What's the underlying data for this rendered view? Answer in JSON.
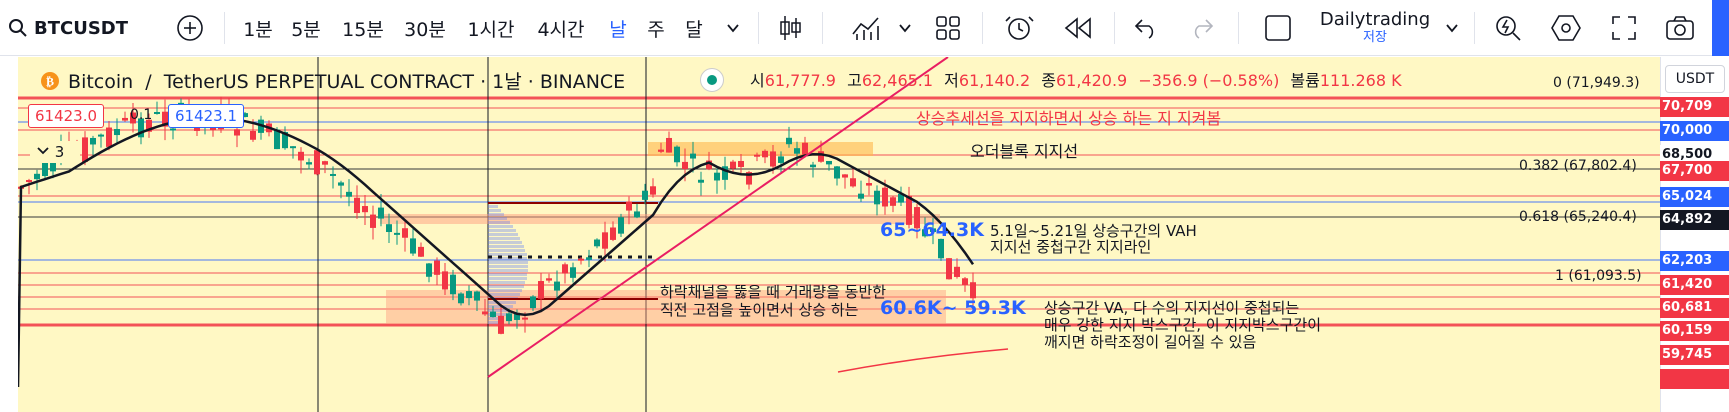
{
  "toolbar": {
    "symbol": "BTCUSDT",
    "intervals": [
      "1분",
      "5분",
      "15분",
      "30분",
      "1시간",
      "4시간",
      "날",
      "주",
      "달"
    ],
    "active_interval": "날",
    "layout_name": "Dailytrading",
    "save_label": "저장"
  },
  "legend": {
    "base": "Bitcoin",
    "sep": "/",
    "quote": "TetherUS PERPETUAL CONTRACT · 1날 · BINANCE",
    "o_label": "시",
    "o_value": "61,777.9",
    "h_label": "고",
    "h_value": "62,465.1",
    "l_label": "저",
    "l_value": "61,140.2",
    "c_label": "종",
    "c_value": "61,420.9",
    "change": "−356.9 (−0.58%)",
    "vol_label": "볼륨",
    "vol_value": "111.268 K"
  },
  "order": {
    "sell_price": "61423.0",
    "spread": "0.1",
    "buy_price": "61423.1",
    "collapse_count": "3"
  },
  "currency": "USDT",
  "fib_levels": [
    {
      "label": "0 (71,949.3)"
    },
    {
      "label": "0.382 (67,802.4)"
    },
    {
      "label": "0.618 (65,240.4)"
    },
    {
      "label": "1 (61,093.5)"
    }
  ],
  "annotations": {
    "trend_support": "상승추세선을 지지하면서 상승 하는 지 지켜봄",
    "orderblock": "오더블록 지지선",
    "vah_line1": "5.1일~5.21일 상승구간의 VAH",
    "vah_line2": "지지선 중첩구간 지지라인",
    "range_6564": "65~64.3K",
    "range_6059": "60.6K~ 59.3K",
    "breakout_line1": "하락채널을 뚫을 때 거래량을 동반한",
    "breakout_line2": "직전 고점을 높이면서 상승 하는",
    "box_line1": "상승구간 VA, 다 수의 지지선이 중첩되는",
    "box_line2": "매우 강한 지지 박스구간, 이 지지박스구간이",
    "box_line3": "깨지면 하락조정이 길어질 수 있음"
  },
  "price_axis": [
    {
      "label": "70,709",
      "color": "#f23645"
    },
    {
      "label": "70,000",
      "color": "#2962ff"
    },
    {
      "label": "68,500",
      "color": "#ffffff"
    },
    {
      "label": "67,700",
      "color": "#f23645"
    },
    {
      "label": "65,024",
      "color": "#2962ff"
    },
    {
      "label": "64,892",
      "color": "#131722"
    },
    {
      "label": "62,203",
      "color": "#2962ff"
    },
    {
      "label": "61,420",
      "color": "#f23645"
    },
    {
      "label": "60,681",
      "color": "#f23645"
    },
    {
      "label": "60,159",
      "color": "#f23645"
    },
    {
      "label": "59,745",
      "color": "#f23645"
    }
  ],
  "colors": {
    "up": "#089981",
    "down": "#f23645",
    "accent": "#2962ff",
    "chart_bg": "#fff8c4"
  }
}
